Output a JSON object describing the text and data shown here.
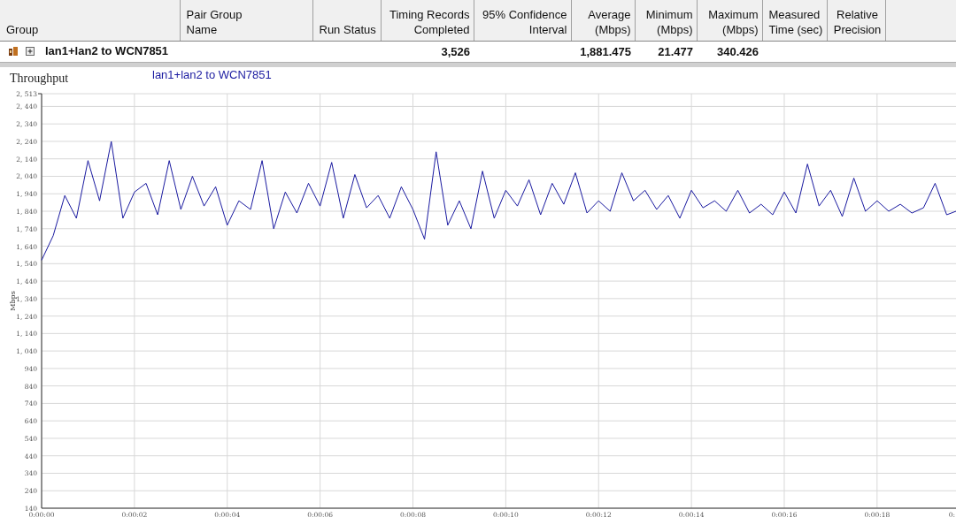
{
  "table": {
    "columns": [
      "Group",
      "Pair Group\nName",
      "Run Status",
      "Timing Records\nCompleted",
      "95% Confidence\nInterval",
      "Average\n(Mbps)",
      "Minimum\n(Mbps)",
      "Maximum\n(Mbps)",
      "Measured\nTime (sec)",
      "Relative\nPrecision"
    ],
    "rows": [
      {
        "cells": [
          "lan1+lan2 to WCN7851",
          null,
          null,
          "3,526",
          null,
          "1,881.475",
          "21.477",
          "340.426",
          null,
          null
        ],
        "expanded": false
      }
    ]
  },
  "chart": {
    "title": "Throughput",
    "cut_tick_label": "0:",
    "chart_data": {
      "type": "line",
      "grid": true,
      "ylabel": "Mbps",
      "xlim": [
        0,
        19.7
      ],
      "ylim": [
        140,
        2513
      ],
      "xticks": [
        {
          "value": 0,
          "label": "0:00:00"
        },
        {
          "value": 2,
          "label": "0:00:02"
        },
        {
          "value": 4,
          "label": "0:00:04"
        },
        {
          "value": 6,
          "label": "0:00:06"
        },
        {
          "value": 8,
          "label": "0:00:08"
        },
        {
          "value": 10,
          "label": "0:00:10"
        },
        {
          "value": 12,
          "label": "0:00:12"
        },
        {
          "value": 14,
          "label": "0:00:14"
        },
        {
          "value": 16,
          "label": "0:00:16"
        },
        {
          "value": 18,
          "label": "0:00:18"
        }
      ],
      "yticks": [
        140,
        240,
        340,
        440,
        540,
        640,
        740,
        840,
        940,
        {
          "value": 1040,
          "label": "1, 040"
        },
        {
          "value": 1140,
          "label": "1, 140"
        },
        {
          "value": 1240,
          "label": "1, 240"
        },
        {
          "value": 1340,
          "label": "1, 340"
        },
        {
          "value": 1440,
          "label": "1, 440"
        },
        {
          "value": 1540,
          "label": "1, 540"
        },
        {
          "value": 1640,
          "label": "1, 640"
        },
        {
          "value": 1740,
          "label": "1, 740"
        },
        {
          "value": 1840,
          "label": "1, 840"
        },
        {
          "value": 1940,
          "label": "1, 940"
        },
        {
          "value": 2040,
          "label": "2, 040"
        },
        {
          "value": 2140,
          "label": "2, 140"
        },
        {
          "value": 2240,
          "label": "2, 240"
        },
        {
          "value": 2340,
          "label": "2, 340"
        },
        {
          "value": 2440,
          "label": "2, 440"
        },
        {
          "value": 2513,
          "label": "2, 513"
        }
      ],
      "x": [
        0,
        0.25,
        0.5,
        0.75,
        1,
        1.25,
        1.5,
        1.75,
        2,
        2.25,
        2.5,
        2.75,
        3,
        3.25,
        3.5,
        3.75,
        4,
        4.25,
        4.5,
        4.75,
        5,
        5.25,
        5.5,
        5.75,
        6,
        6.25,
        6.5,
        6.75,
        7,
        7.25,
        7.5,
        7.75,
        8,
        8.25,
        8.5,
        8.75,
        9,
        9.25,
        9.5,
        9.75,
        10,
        10.25,
        10.5,
        10.75,
        11,
        11.25,
        11.5,
        11.75,
        12,
        12.25,
        12.5,
        12.75,
        13,
        13.25,
        13.5,
        13.75,
        14,
        14.25,
        14.5,
        14.75,
        15,
        15.25,
        15.5,
        15.75,
        16,
        16.25,
        16.5,
        16.75,
        17,
        17.25,
        17.5,
        17.75,
        18,
        18.25,
        18.5,
        18.75,
        19,
        19.25,
        19.5,
        19.7
      ],
      "series": [
        {
          "name": "lan1+lan2 to WCN7851",
          "color": "#1a1aa0",
          "values": [
            1560,
            1700,
            1930,
            1800,
            2130,
            1900,
            2240,
            1800,
            1950,
            2000,
            1820,
            2130,
            1850,
            2040,
            1870,
            1980,
            1760,
            1900,
            1850,
            2130,
            1740,
            1950,
            1830,
            2000,
            1870,
            2120,
            1800,
            2050,
            1860,
            1930,
            1800,
            1980,
            1850,
            1680,
            2180,
            1760,
            1900,
            1740,
            2070,
            1800,
            1960,
            1870,
            2020,
            1820,
            2000,
            1880,
            2060,
            1830,
            1900,
            1840,
            2060,
            1900,
            1960,
            1850,
            1930,
            1800,
            1960,
            1860,
            1900,
            1840,
            1960,
            1830,
            1880,
            1820,
            1950,
            1830,
            2110,
            1870,
            1960,
            1810,
            2030,
            1840,
            1900,
            1840,
            1880,
            1830,
            1860,
            2000,
            1820,
            1840
          ]
        }
      ]
    }
  }
}
